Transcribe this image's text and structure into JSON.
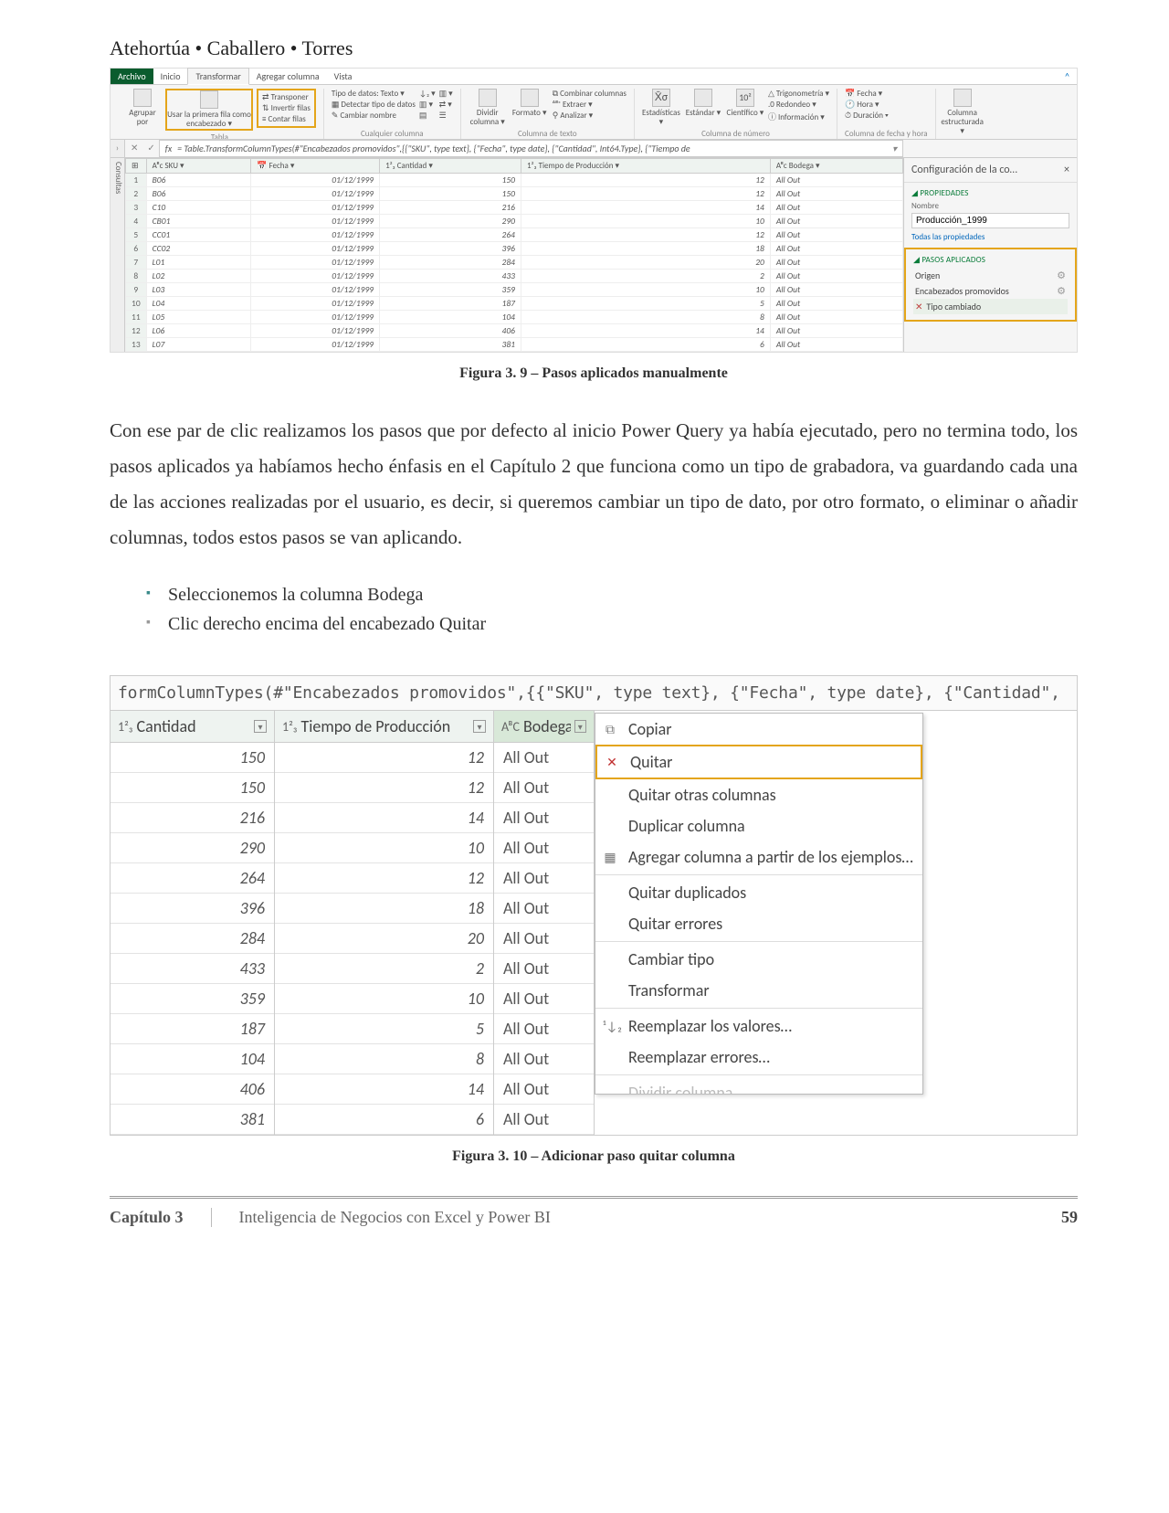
{
  "byline": "Atehortúa • Caballero • Torres",
  "pq_tabs": {
    "archivo": "Archivo",
    "inicio": "Inicio",
    "transformar": "Transformar",
    "agregar": "Agregar columna",
    "vista": "Vista",
    "help": "^"
  },
  "ribbon": {
    "tabla": {
      "agrupar": "Agrupar por",
      "primera": "Usar la primera fila como encabezado ▾",
      "transponer": "Transponer",
      "invertir": "Invertir filas",
      "contar": "Contar filas",
      "label": "Tabla"
    },
    "cualquier": {
      "tipo": "Tipo de datos: Texto ▾",
      "detectar": "Detectar tipo de datos",
      "cambiar": "Cambiar nombre",
      "label": "Cualquier columna"
    },
    "texto": {
      "dividir": "Dividir columna ▾",
      "formato": "Formato ▾",
      "combinar": "Combinar columnas",
      "extraer": "Extraer ▾",
      "analizar": "Analizar ▾",
      "label": "Columna de texto"
    },
    "numero": {
      "est": "Estadísticas ▾",
      "std": "Estándar ▾",
      "cien": "Científico ▾",
      "trig": "Trigonometría ▾",
      "red": "Redondeo ▾",
      "info": "Información ▾",
      "label": "Columna de número"
    },
    "fecha": {
      "fecha": "Fecha ▾",
      "hora": "Hora ▾",
      "dur": "Duración ▾",
      "label": "Columna de fecha y hora"
    },
    "estr": {
      "col": "Columna estructurada ▾"
    }
  },
  "formula": "= Table.TransformColumnTypes(#\"Encabezados promovidos\",{{\"SKU\", type text}, {\"Fecha\", type date}, {\"Cantidad\", Int64.Type}, {\"Tiempo de",
  "sidebar_left": "Consultas",
  "cols": {
    "sku": "SKU",
    "fecha": "Fecha",
    "cant": "Cantidad",
    "tiempo": "Tiempo de Producción",
    "bodega": "Bodega"
  },
  "rows": [
    {
      "i": 1,
      "sku": "B06",
      "f": "01/12/1999",
      "c": 150,
      "t": 12,
      "b": "All Out"
    },
    {
      "i": 2,
      "sku": "B06",
      "f": "01/12/1999",
      "c": 150,
      "t": 12,
      "b": "All Out"
    },
    {
      "i": 3,
      "sku": "C10",
      "f": "01/12/1999",
      "c": 216,
      "t": 14,
      "b": "All Out"
    },
    {
      "i": 4,
      "sku": "CB01",
      "f": "01/12/1999",
      "c": 290,
      "t": 10,
      "b": "All Out"
    },
    {
      "i": 5,
      "sku": "CC01",
      "f": "01/12/1999",
      "c": 264,
      "t": 12,
      "b": "All Out"
    },
    {
      "i": 6,
      "sku": "CC02",
      "f": "01/12/1999",
      "c": 396,
      "t": 18,
      "b": "All Out"
    },
    {
      "i": 7,
      "sku": "L01",
      "f": "01/12/1999",
      "c": 284,
      "t": 20,
      "b": "All Out"
    },
    {
      "i": 8,
      "sku": "L02",
      "f": "01/12/1999",
      "c": 433,
      "t": 2,
      "b": "All Out"
    },
    {
      "i": 9,
      "sku": "L03",
      "f": "01/12/1999",
      "c": 359,
      "t": 10,
      "b": "All Out"
    },
    {
      "i": 10,
      "sku": "L04",
      "f": "01/12/1999",
      "c": 187,
      "t": 5,
      "b": "All Out"
    },
    {
      "i": 11,
      "sku": "L05",
      "f": "01/12/1999",
      "c": 104,
      "t": 8,
      "b": "All Out"
    },
    {
      "i": 12,
      "sku": "L06",
      "f": "01/12/1999",
      "c": 406,
      "t": 14,
      "b": "All Out"
    },
    {
      "i": 13,
      "sku": "L07",
      "f": "01/12/1999",
      "c": 381,
      "t": 6,
      "b": "All Out"
    }
  ],
  "config": {
    "title": "Configuración de la co…",
    "prop_h": "PROPIEDADES",
    "nombre_l": "Nombre",
    "nombre_v": "Producción_1999",
    "todas": "Todas las propiedades",
    "pasos_h": "PASOS APLICADOS",
    "steps": {
      "origen": "Origen",
      "enc": "Encabezados promovidos",
      "tipo": "Tipo cambiado"
    }
  },
  "fig1": "Figura 3. 9 – Pasos aplicados manualmente",
  "para": "Con ese par de clic realizamos los pasos que por defecto al inicio Power Query ya había ejecutado, pero no termina todo, los pasos aplicados ya habíamos hecho énfasis en el Capítulo 2 que funciona como un tipo de grabadora, va guardando cada una de las acciones realizadas por el usuario, es decir, si queremos cambiar un tipo de dato, por otro formato, o eliminar o añadir columnas, todos estos pasos se van aplicando.",
  "bullets": {
    "a": "Seleccionemos la columna Bodega",
    "b": "Clic derecho encima del encabezado Quitar"
  },
  "pq2": {
    "formula": "formColumnTypes(#\"Encabezados promovidos\",{{\"SKU\", type text}, {\"Fecha\", type date}, {\"Cantidad\",",
    "col_cant": "Cantidad",
    "col_tiempo": "Tiempo de Producción",
    "col_bod": "Bodega",
    "type_num": "1²₃",
    "type_txt": "AᴮC",
    "menu": {
      "copiar": "Copiar",
      "quitar": "Quitar",
      "quitar_otras": "Quitar otras columnas",
      "duplicar": "Duplicar columna",
      "agregar": "Agregar columna a partir de los ejemplos…",
      "qdup": "Quitar duplicados",
      "qerr": "Quitar errores",
      "cambiar": "Cambiar tipo",
      "transf": "Transformar",
      "reempv": "Reemplazar los valores…",
      "reemper": "Reemplazar errores…",
      "div": "Dividir columna"
    }
  },
  "fig2": "Figura 3. 10 – Adicionar paso quitar columna",
  "footer": {
    "chapter": "Capítulo 3",
    "title": "Inteligencia de Negocios con Excel y Power BI",
    "page": "59"
  }
}
